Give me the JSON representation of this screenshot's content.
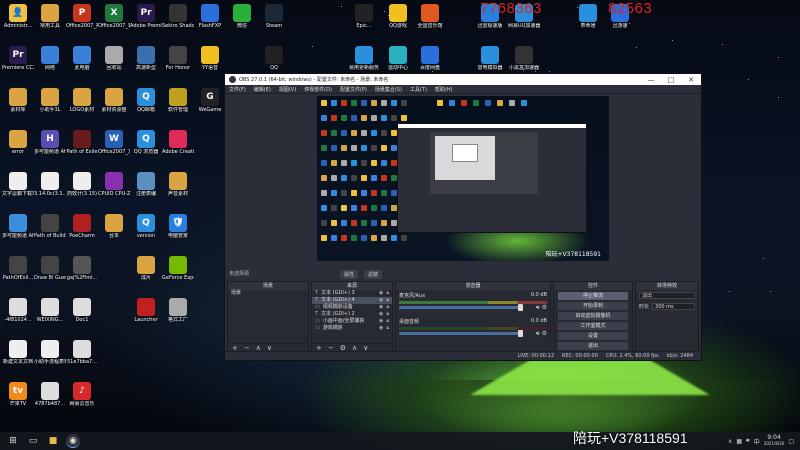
{
  "overlay": {
    "left_number": "7768363",
    "right_number": "82563"
  },
  "watermark": "陪玩+V378118591",
  "desktop_icons": [
    {
      "label": "Administr...",
      "color": "#f0c040",
      "glyph": "👤"
    },
    {
      "label": "Premiere CC2019",
      "color": "#2a1b4d",
      "glyph": "Pr"
    },
    {
      "label": "素材库",
      "color": "#d9a441",
      "glyph": ""
    },
    {
      "label": "error",
      "color": "#d9a441",
      "glyph": ""
    },
    {
      "label": "文字逗霸下载地址",
      "color": "#eeeeee",
      "glyph": ""
    },
    {
      "label": "多可能频道 AHK(20.19...",
      "color": "#3a8fdc",
      "glyph": ""
    },
    {
      "label": "PathOfExil...",
      "color": "#444444",
      "glyph": ""
    },
    {
      "label": "-4f81024...",
      "color": "#dddddd",
      "glyph": ""
    },
    {
      "label": "新建文本文档",
      "color": "#eeeeee",
      "glyph": ""
    },
    {
      "label": "芒果TV",
      "color": "#f08a1a",
      "glyph": "tv"
    },
    {
      "label": "常用工具",
      "color": "#d9a441",
      "glyph": ""
    },
    {
      "label": "网络",
      "color": "#3a7fd9",
      "glyph": ""
    },
    {
      "label": "小助手3L",
      "color": "#d9a441",
      "glyph": ""
    },
    {
      "label": "多可能频道 AHK",
      "color": "#5a4fb0",
      "glyph": "H"
    },
    {
      "label": "3.14.0c(3.1...",
      "color": "#eeeeee",
      "glyph": ""
    },
    {
      "label": "Path of Building",
      "color": "#444444",
      "glyph": ""
    },
    {
      "label": "Draw Bi Guess",
      "color": "#444444",
      "glyph": ""
    },
    {
      "label": "WEIXING...",
      "color": "#dddddd",
      "glyph": ""
    },
    {
      "label": "小助手流程表格两...",
      "color": "#eeeeee",
      "glyph": ""
    },
    {
      "label": "4787b487...",
      "color": "#dddddd",
      "glyph": ""
    },
    {
      "label": "Office2007_打打HT",
      "color": "#c8351d",
      "glyph": "P"
    },
    {
      "label": "此电脑",
      "color": "#3a7fd9",
      "glyph": ""
    },
    {
      "label": "LOGO素材",
      "color": "#d9a441",
      "glyph": ""
    },
    {
      "label": "Path of Exile",
      "color": "#6a1a1a",
      "glyph": ""
    },
    {
      "label": "药效计(3.15)",
      "color": "#eeeeee",
      "glyph": ""
    },
    {
      "label": "PoeCharm",
      "color": "#b02020",
      "glyph": ""
    },
    {
      "label": "gaj%2Fimi...",
      "color": "#555555",
      "glyph": ""
    },
    {
      "label": "Doc1",
      "color": "#dddddd",
      "glyph": ""
    },
    {
      "label": "51e7bba7...",
      "color": "#dddddd",
      "glyph": ""
    },
    {
      "label": "网易云音乐",
      "color": "#d62a2a",
      "glyph": "♪"
    },
    {
      "label": "Office2007_表格",
      "color": "#1e7a3c",
      "glyph": "X"
    },
    {
      "label": "回收站",
      "color": "#aaaaaa",
      "glyph": ""
    },
    {
      "label": "素材资源整",
      "color": "#d9a441",
      "glyph": ""
    },
    {
      "label": "Office2007_文字",
      "color": "#2a5fb8",
      "glyph": "W"
    },
    {
      "label": "CPUID CPU-Z",
      "color": "#8a2fb0",
      "glyph": ""
    },
    {
      "label": "台本",
      "color": "#d9a441",
      "glyph": ""
    },
    {
      "label": "Adobe Premie...",
      "color": "#2a1b4d",
      "glyph": "Pr"
    },
    {
      "label": "高速新型",
      "color": "#3a6fb0",
      "glyph": ""
    },
    {
      "label": "QQ邮箱",
      "color": "#2a8fdc",
      "glyph": "Q"
    },
    {
      "label": "QQ 浏览器",
      "color": "#2a8fdc",
      "glyph": "Q"
    },
    {
      "label": "注册表编",
      "color": "#5a8fc0",
      "glyph": ""
    },
    {
      "label": "version",
      "color": "#2a8fdc",
      "glyph": "Q"
    },
    {
      "label": "成片",
      "color": "#d9a441",
      "glyph": ""
    },
    {
      "label": "Launcher",
      "color": "#c02020",
      "glyph": ""
    },
    {
      "label": "Sekiro Shadow...",
      "color": "#333333",
      "glyph": ""
    },
    {
      "label": "For Honor",
      "color": "#444444",
      "glyph": ""
    },
    {
      "label": "软件管理",
      "color": "#c0a020",
      "glyph": ""
    },
    {
      "label": "Adobe Creati...",
      "color": "#e02a5a",
      "glyph": ""
    },
    {
      "label": "声音素材",
      "color": "#d9a441",
      "glyph": ""
    },
    {
      "label": "电脑管家",
      "color": "#2a7fdc",
      "glyph": "🛡"
    },
    {
      "label": "GeForce Experience",
      "color": "#76b900",
      "glyph": ""
    },
    {
      "label": "格式工厂",
      "color": "#aaaaaa",
      "glyph": ""
    },
    {
      "label": "FlashFXP",
      "color": "#2a6fdc",
      "glyph": ""
    },
    {
      "label": "YY语音",
      "color": "#f0c020",
      "glyph": ""
    },
    {
      "label": "WeGame",
      "color": "#222222",
      "glyph": "G"
    },
    {
      "label": "微信",
      "color": "#2ab03a",
      "glyph": ""
    },
    {
      "label": "Steam",
      "color": "#1b2838",
      "glyph": ""
    },
    {
      "label": "QQ",
      "color": "#222222",
      "glyph": ""
    },
    {
      "label": "Epic...",
      "color": "#222222",
      "glyph": ""
    },
    {
      "label": "易用更新服务",
      "color": "#2a8fdc",
      "glyph": ""
    },
    {
      "label": "QQ游戏",
      "color": "#f0c020",
      "glyph": ""
    },
    {
      "label": "运动中心",
      "color": "#2ab0c0",
      "glyph": ""
    },
    {
      "label": "全国音乐馆",
      "color": "#e05a20",
      "glyph": ""
    },
    {
      "label": "百度网盘",
      "color": "#2a6fdc",
      "glyph": ""
    },
    {
      "label": "迅雷极速版",
      "color": "#2a7fdc",
      "glyph": ""
    },
    {
      "label": "雷电模拟器",
      "color": "#2a8fdc",
      "glyph": ""
    },
    {
      "label": "网易UU加速器",
      "color": "#2a8fdc",
      "glyph": ""
    },
    {
      "label": "小黑盒加速器",
      "color": "#333333",
      "glyph": ""
    },
    {
      "label": "寿命通",
      "color": "#2a8fdc",
      "glyph": ""
    },
    {
      "label": "迅游速",
      "color": "#2a6fdc",
      "glyph": ""
    }
  ],
  "obs": {
    "title": "OBS 27.0.1 (64-bit, windows) - 配置文件: 未命名 - 场景: 未命名",
    "window_controls": [
      "—",
      "□",
      "✕"
    ],
    "menu": [
      "文件(F)",
      "编辑(E)",
      "视图(V)",
      "停靠部件(D)",
      "配置文件(P)",
      "场景集合(S)",
      "工具(T)",
      "帮助(H)"
    ],
    "no_source": "未选择源",
    "scene_tabs": [
      "属性",
      "滤镜"
    ],
    "preview_watermark": "陪玩+V378118591",
    "scenes": {
      "header": "场景",
      "items": [
        "场景"
      ],
      "footer": [
        "+",
        "−",
        "∧",
        "∨"
      ]
    },
    "sources": {
      "header": "来源",
      "items": [
        {
          "type": "T",
          "name": "文本 (GDI+) 3"
        },
        {
          "type": "T",
          "name": "文本 (GDI+) 4"
        },
        {
          "type": "▭",
          "name": "视频捕获设备"
        },
        {
          "type": "T",
          "name": "文本 (GDI+) 2"
        },
        {
          "type": "▭",
          "name": "小画中画/全屏捕获"
        },
        {
          "type": "▭",
          "name": "游戏捕获"
        }
      ],
      "footer": [
        "+",
        "−",
        "⚙",
        "∧",
        "∨"
      ]
    },
    "mixer": {
      "header": "混音器",
      "channels": [
        {
          "name": "麦克风/Aux",
          "level": "0.0 dB"
        },
        {
          "name": "桌面音频",
          "level": "0.0 dB"
        }
      ]
    },
    "controls": {
      "header": "控件",
      "buttons": [
        "停止推流",
        "开始录制",
        "启动虚拟摄像机",
        "工作室模式",
        "设置",
        "退出"
      ]
    },
    "transitions": {
      "header": "转场特效",
      "type": "淡出",
      "duration_label": "时长",
      "duration": "300 ms"
    },
    "status": {
      "live": "LIVE: 00:00:12",
      "rec": "REC: 00:00:00",
      "cpu": "CPU: 2.4%, 60.00 fps",
      "kbps": "kb/s: 2484"
    }
  },
  "taskbar": {
    "start_icon": "windows-icon",
    "time": "9:04",
    "date": "2021/9/20",
    "tray_text": "中"
  }
}
